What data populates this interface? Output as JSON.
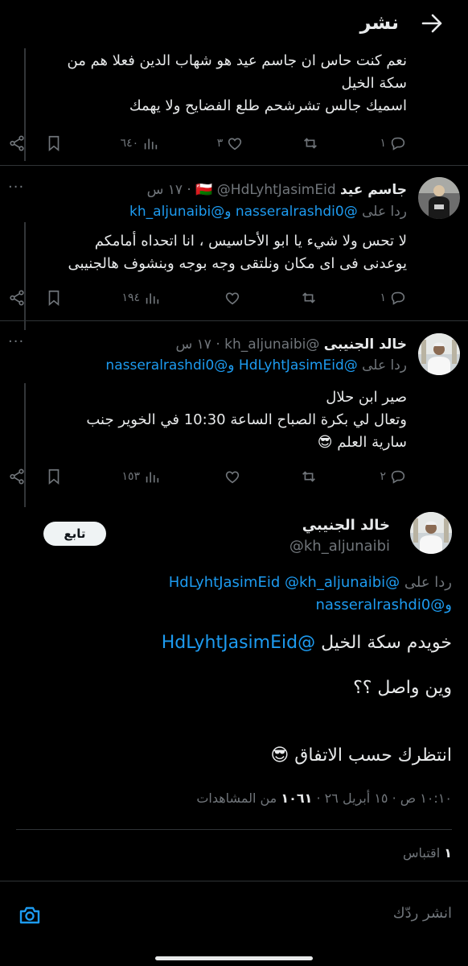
{
  "header": {
    "title": "نشر"
  },
  "tweet0": {
    "lines": [
      "نعم كنت حاس ان جاسم عيد هو شهاب الدين فعلا هم من",
      "سكة الخيل",
      "اسميك جالس تشرشحم طلع الفضايح ولا يهمك"
    ],
    "stats": {
      "replies": "١",
      "reposts": "",
      "likes": "٣",
      "views": "٦٤٠"
    }
  },
  "tweet1": {
    "name": "جاسم عيد",
    "flag": "🇴🇲",
    "handle": "@HdLyhtJasimEid",
    "time": "١٧ س",
    "reply_prefix": "ردا على",
    "reply_mention1": "@nasseralrashdi0",
    "reply_and": "و",
    "reply_mention2": "@kh_aljunaibi",
    "lines": [
      "لا تحس ولا شيء يا ابو الأحاسيس ، انا اتحداه أمامكم",
      "يوعدنى فى اى مكان ونلتقى وجه بوجه وبنشوف هالجنيبى"
    ],
    "stats": {
      "replies": "١",
      "reposts": "",
      "likes": "",
      "views": "١٩٤"
    }
  },
  "tweet2": {
    "name": "خالد الجنيبى",
    "handle": "@kh_aljunaibi",
    "time": "١٧ س",
    "reply_prefix": "ردا على",
    "reply_mention1": "@HdLyhtJasimEid",
    "reply_and": "و",
    "reply_mention2": "@nasseralrashdi0",
    "lines": [
      "صير ابن حلال",
      "وتعال لي بكرة الصباح الساعة 10:30 في الخوير جنب",
      "سارية العلم 😎"
    ],
    "stats": {
      "replies": "٢",
      "reposts": "",
      "likes": "",
      "views": "١٥٣"
    }
  },
  "main": {
    "name": "خالد الجنيبي",
    "handle": "@kh_aljunaibi",
    "follow_label": "تابع",
    "reply_prefix": "ردا على",
    "reply_mention1": "@HdLyhtJasimEid",
    "reply_mention2": "@kh_aljunaibi",
    "reply_and": "و",
    "reply_mention3": "@nasseralrashdi0",
    "line1_text": "خويدم سكة الخيل",
    "line1_mention": "@HdLyhtJasimEid",
    "line2": "وين واصل ؟؟",
    "line3": "انتظرك حسب الاتفاق 😎",
    "time": "١٠:١٠ ص",
    "date": "١٥ أبريل ٢٦",
    "views_count": "١٠٦١",
    "views_label": "من المشاهدات",
    "sep": "·",
    "quotes_count": "١",
    "quotes_label": "اقتباس"
  },
  "composer": {
    "placeholder": "انشر ردّك"
  }
}
